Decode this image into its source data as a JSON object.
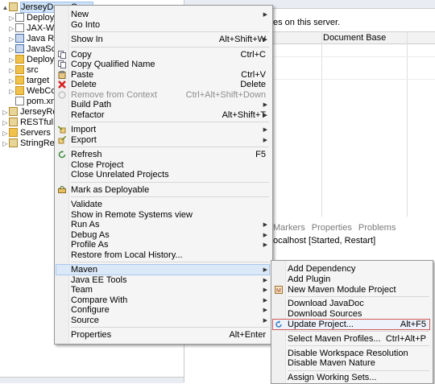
{
  "explorer": {
    "items": [
      {
        "label": "JerseyDemoGene",
        "indent": 1,
        "tri": "▲",
        "icon": "project-icon",
        "selected": true
      },
      {
        "label": "Deploym",
        "indent": 2,
        "tri": "▷",
        "icon": "file-icon"
      },
      {
        "label": "JAX-WS W",
        "indent": 2,
        "tri": "▷",
        "icon": "file-icon"
      },
      {
        "label": "Java Reso",
        "indent": 2,
        "tri": "▷",
        "icon": "library-icon"
      },
      {
        "label": "JavaScrip",
        "indent": 2,
        "tri": "▷",
        "icon": "library-icon"
      },
      {
        "label": "Deployed",
        "indent": 2,
        "tri": "▷",
        "icon": "folder-icon"
      },
      {
        "label": "src",
        "indent": 2,
        "tri": "▷",
        "icon": "folder-icon"
      },
      {
        "label": "target",
        "indent": 2,
        "tri": "▷",
        "icon": "folder-icon"
      },
      {
        "label": "WebConte",
        "indent": 2,
        "tri": "▷",
        "icon": "folder-icon"
      },
      {
        "label": "pom.xml",
        "indent": 2,
        "tri": "",
        "icon": "file-icon"
      },
      {
        "label": "JerseyRestfu",
        "indent": 1,
        "tri": "▷",
        "icon": "project-icon"
      },
      {
        "label": "RESTfulExar",
        "indent": 1,
        "tri": "▷",
        "icon": "project-icon"
      },
      {
        "label": "Servers",
        "indent": 1,
        "tri": "▷",
        "icon": "folder-icon"
      },
      {
        "label": "StringRestW",
        "indent": 1,
        "tri": "▷",
        "icon": "project-icon"
      }
    ]
  },
  "right_pane": {
    "server_message": "es on this server.",
    "column_header": "Document Base",
    "bottom_tabs": [
      "Markers",
      "Properties",
      "Problems"
    ],
    "server_line": "ocalhost  [Started, Restart]"
  },
  "context_menu": {
    "items": [
      {
        "label": "New",
        "submenu": true
      },
      {
        "label": "Go Into"
      },
      {
        "separator": true
      },
      {
        "label": "Show In",
        "shortcut": "Alt+Shift+W",
        "submenu": true
      },
      {
        "separator": true
      },
      {
        "label": "Copy",
        "shortcut": "Ctrl+C",
        "icon": "copy-icon"
      },
      {
        "label": "Copy Qualified Name",
        "icon": "copy-icon"
      },
      {
        "label": "Paste",
        "shortcut": "Ctrl+V",
        "icon": "paste-icon"
      },
      {
        "label": "Delete",
        "shortcut": "Delete",
        "icon": "delete-icon"
      },
      {
        "label": "Remove from Context",
        "shortcut": "Ctrl+Alt+Shift+Down",
        "disabled": true,
        "icon": "remove-icon"
      },
      {
        "label": "Build Path",
        "submenu": true
      },
      {
        "label": "Refactor",
        "shortcut": "Alt+Shift+T",
        "submenu": true
      },
      {
        "separator": true
      },
      {
        "label": "Import",
        "submenu": true,
        "icon": "import-icon"
      },
      {
        "label": "Export",
        "submenu": true,
        "icon": "export-icon"
      },
      {
        "separator": true
      },
      {
        "label": "Refresh",
        "shortcut": "F5",
        "icon": "refresh-icon"
      },
      {
        "label": "Close Project"
      },
      {
        "label": "Close Unrelated Projects"
      },
      {
        "separator": true
      },
      {
        "label": "Mark as Deployable",
        "icon": "deploy-icon"
      },
      {
        "separator": true
      },
      {
        "label": "Validate"
      },
      {
        "label": "Show in Remote Systems view"
      },
      {
        "label": "Run As",
        "submenu": true
      },
      {
        "label": "Debug As",
        "submenu": true
      },
      {
        "label": "Profile As",
        "submenu": true
      },
      {
        "label": "Restore from Local History..."
      },
      {
        "separator": true
      },
      {
        "label": "Maven",
        "submenu": true,
        "highlighted": true
      },
      {
        "label": "Java EE Tools",
        "submenu": true
      },
      {
        "label": "Team",
        "submenu": true
      },
      {
        "label": "Compare With",
        "submenu": true
      },
      {
        "label": "Configure",
        "submenu": true
      },
      {
        "label": "Source",
        "submenu": true
      },
      {
        "separator": true
      },
      {
        "label": "Properties",
        "shortcut": "Alt+Enter"
      }
    ]
  },
  "maven_submenu": {
    "items": [
      {
        "label": "Add Dependency"
      },
      {
        "label": "Add Plugin"
      },
      {
        "label": "New Maven Module Project",
        "icon": "maven-module-icon"
      },
      {
        "separator": true
      },
      {
        "label": "Download JavaDoc"
      },
      {
        "label": "Download Sources"
      },
      {
        "label": "Update Project...",
        "shortcut": "Alt+F5",
        "icon": "update-project-icon",
        "highlighted": true
      },
      {
        "separator": true
      },
      {
        "label": "Select Maven Profiles...",
        "shortcut": "Ctrl+Alt+P"
      },
      {
        "separator": true
      },
      {
        "label": "Disable Workspace Resolution"
      },
      {
        "label": "Disable Maven Nature"
      },
      {
        "separator": true
      },
      {
        "label": "Assign Working Sets..."
      }
    ]
  }
}
